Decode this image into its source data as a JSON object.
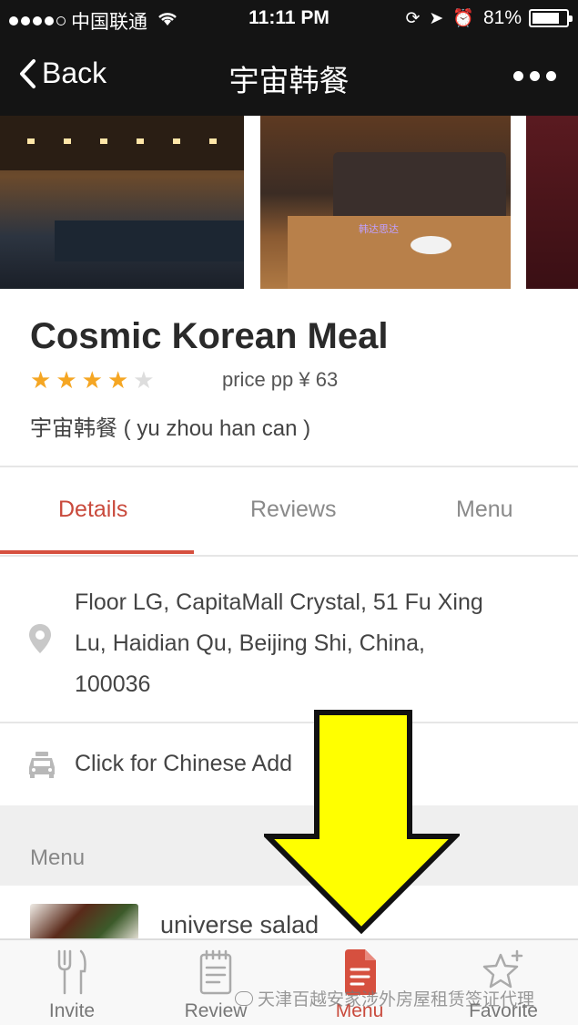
{
  "status_bar": {
    "carrier": "中国联通",
    "time": "11:11 PM",
    "battery": "81%",
    "battery_level": 0.81
  },
  "nav": {
    "back_label": "Back",
    "title": "宇宙韩餐"
  },
  "restaurant": {
    "name": "Cosmic Korean Meal",
    "rating": 4,
    "rating_max": 5,
    "price": "price pp ¥ 63",
    "chinese_name": "宇宙韩餐 ( yu zhou han can )"
  },
  "tabs": [
    {
      "label": "Details"
    },
    {
      "label": "Reviews"
    },
    {
      "label": "Menu"
    }
  ],
  "address": {
    "line1": "Floor LG, CapitaMall Crystal, 51 Fu Xing",
    "line2": "Lu, Haidian Qu, Beijing Shi, China,",
    "line3": "100036",
    "chinese_address_label": "Click for Chinese Add"
  },
  "menu": {
    "header": "Menu",
    "items": [
      {
        "name": "universe salad"
      }
    ]
  },
  "bottom_bar": {
    "invite": "Invite",
    "review": "Review",
    "menu": "Menu",
    "favorite": "Favorite"
  },
  "photo_overlay_text": "韩达思达",
  "watermark": "天津百越安家涉外房屋租赁签证代理",
  "colors": {
    "accent": "#d6503f",
    "star": "#f5a623",
    "arrow": "#ffff00"
  }
}
